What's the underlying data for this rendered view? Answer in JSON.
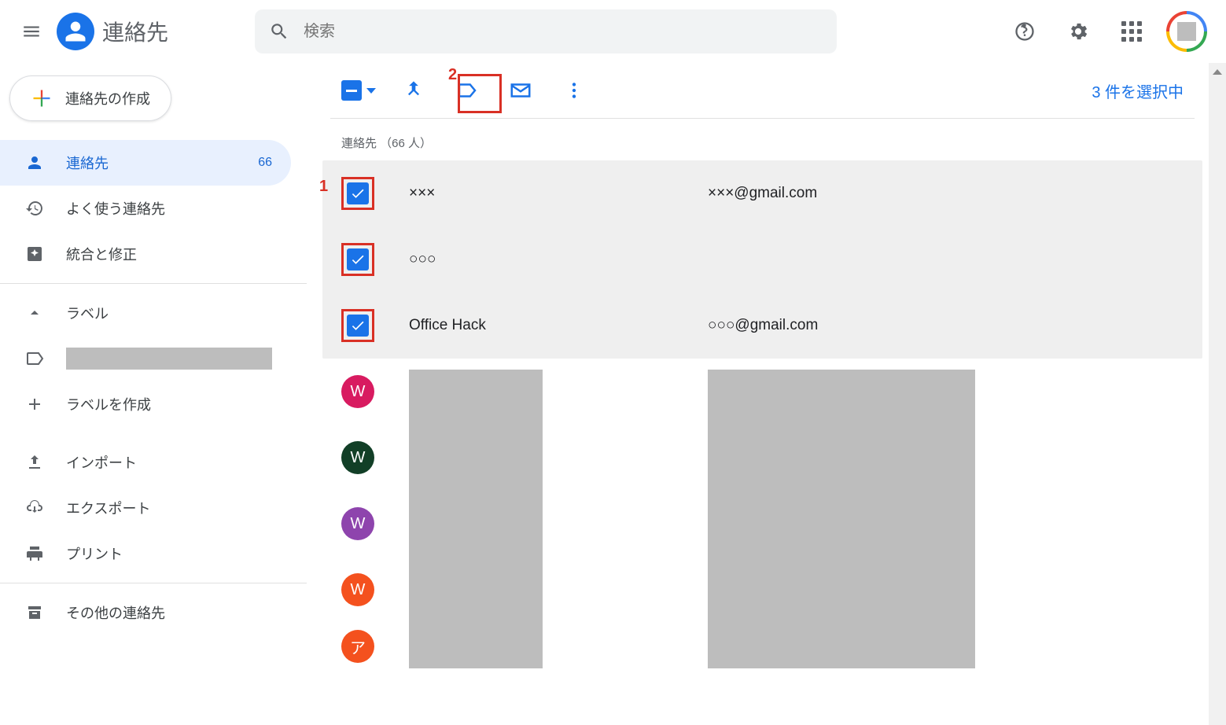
{
  "header": {
    "app_title": "連絡先",
    "search_placeholder": "検索"
  },
  "sidebar": {
    "create_label": "連絡先の作成",
    "items": [
      {
        "label": "連絡先",
        "count": "66"
      },
      {
        "label": "よく使う連絡先"
      },
      {
        "label": "統合と修正"
      }
    ],
    "labels_header": "ラベル",
    "create_label_label": "ラベルを作成",
    "import_label": "インポート",
    "export_label": "エクスポート",
    "print_label": "プリント",
    "other_label": "その他の連絡先"
  },
  "toolbar": {
    "selected_text": "3 件を選択中"
  },
  "annotations": {
    "a1": "1",
    "a2": "2"
  },
  "list": {
    "header": "連絡先 （66 人）",
    "rows": [
      {
        "name": "×××",
        "email": "×××@gmail.com",
        "checked": true
      },
      {
        "name": "○○○",
        "email": "",
        "checked": true
      },
      {
        "name": "Office Hack",
        "email": "○○○@gmail.com",
        "checked": true
      }
    ],
    "avatar_rows": [
      {
        "letter": "W",
        "color": "#d81b60"
      },
      {
        "letter": "W",
        "color": "#1b5e20"
      },
      {
        "letter": "W",
        "color": "#8e44ad"
      },
      {
        "letter": "W",
        "color": "#f4511e"
      },
      {
        "letter": "ア",
        "color": "#f4511e"
      }
    ]
  }
}
